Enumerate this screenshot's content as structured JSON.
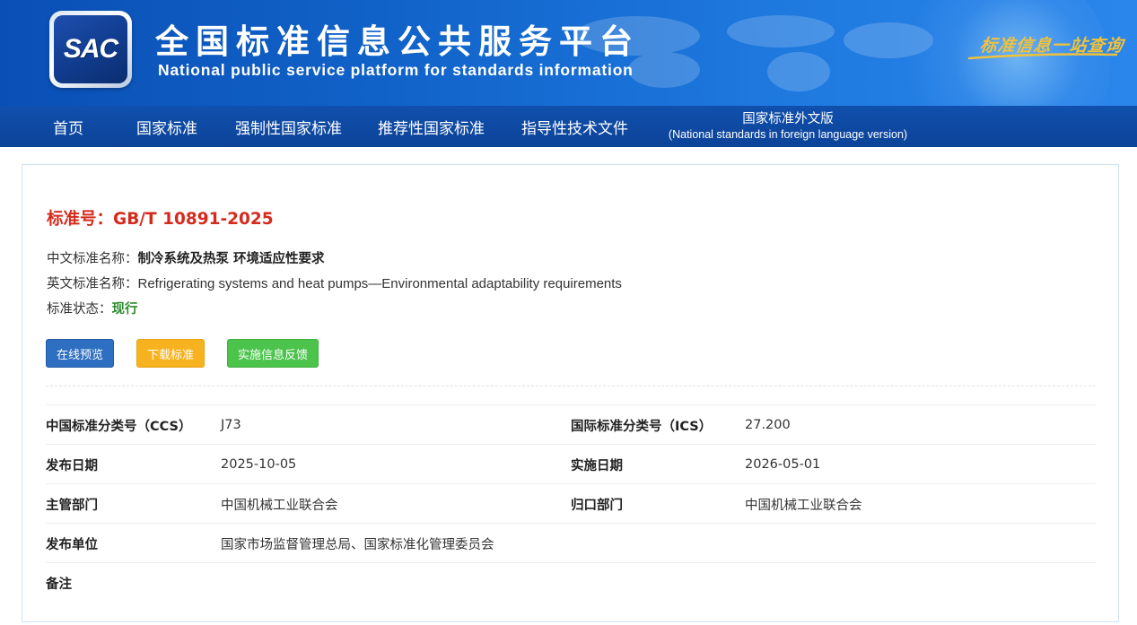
{
  "header": {
    "logo_text": "SAC",
    "title": "全国标准信息公共服务平台",
    "subtitle": "National public service platform  for standards information",
    "slogan": "标准信息一站查询",
    "colors": {
      "banner": "#1163c9",
      "nav": "#0d47a1",
      "slogan": "#f0c23a"
    }
  },
  "nav": {
    "items": [
      {
        "label": "首页"
      },
      {
        "label": "国家标准"
      },
      {
        "label": "强制性国家标准"
      },
      {
        "label": "推荐性国家标准"
      },
      {
        "label": "指导性技术文件"
      }
    ],
    "foreign": {
      "label": "国家标准外文版",
      "sublabel": "(National standards in foreign language version)"
    }
  },
  "standard": {
    "number_label": "标准号：",
    "number": "GB/T 10891-2025",
    "cn_name_label": "中文标准名称：",
    "cn_name": "制冷系统及热泵 环境适应性要求",
    "en_name_label": "英文标准名称：",
    "en_name": "Refrigerating systems and heat pumps—Environmental adaptability requirements",
    "status_label": "标准状态：",
    "status": "现行",
    "status_color": "#2e8b2e"
  },
  "buttons": {
    "preview": "在线预览",
    "download": "下载标准",
    "feedback": "实施信息反馈"
  },
  "details": {
    "ccs_label": "中国标准分类号（CCS）",
    "ccs": "J73",
    "ics_label": "国际标准分类号（ICS）",
    "ics": "27.200",
    "publish_date_label": "发布日期",
    "publish_date": "2025-10-05",
    "impl_date_label": "实施日期",
    "impl_date": "2026-05-01",
    "competent_label": "主管部门",
    "competent": "中国机械工业联合会",
    "centralized_label": "归口部门",
    "centralized": "中国机械工业联合会",
    "publisher_label": "发布单位",
    "publisher": "国家市场监督管理总局、国家标准化管理委员会",
    "remark_label": "备注",
    "remark": ""
  }
}
